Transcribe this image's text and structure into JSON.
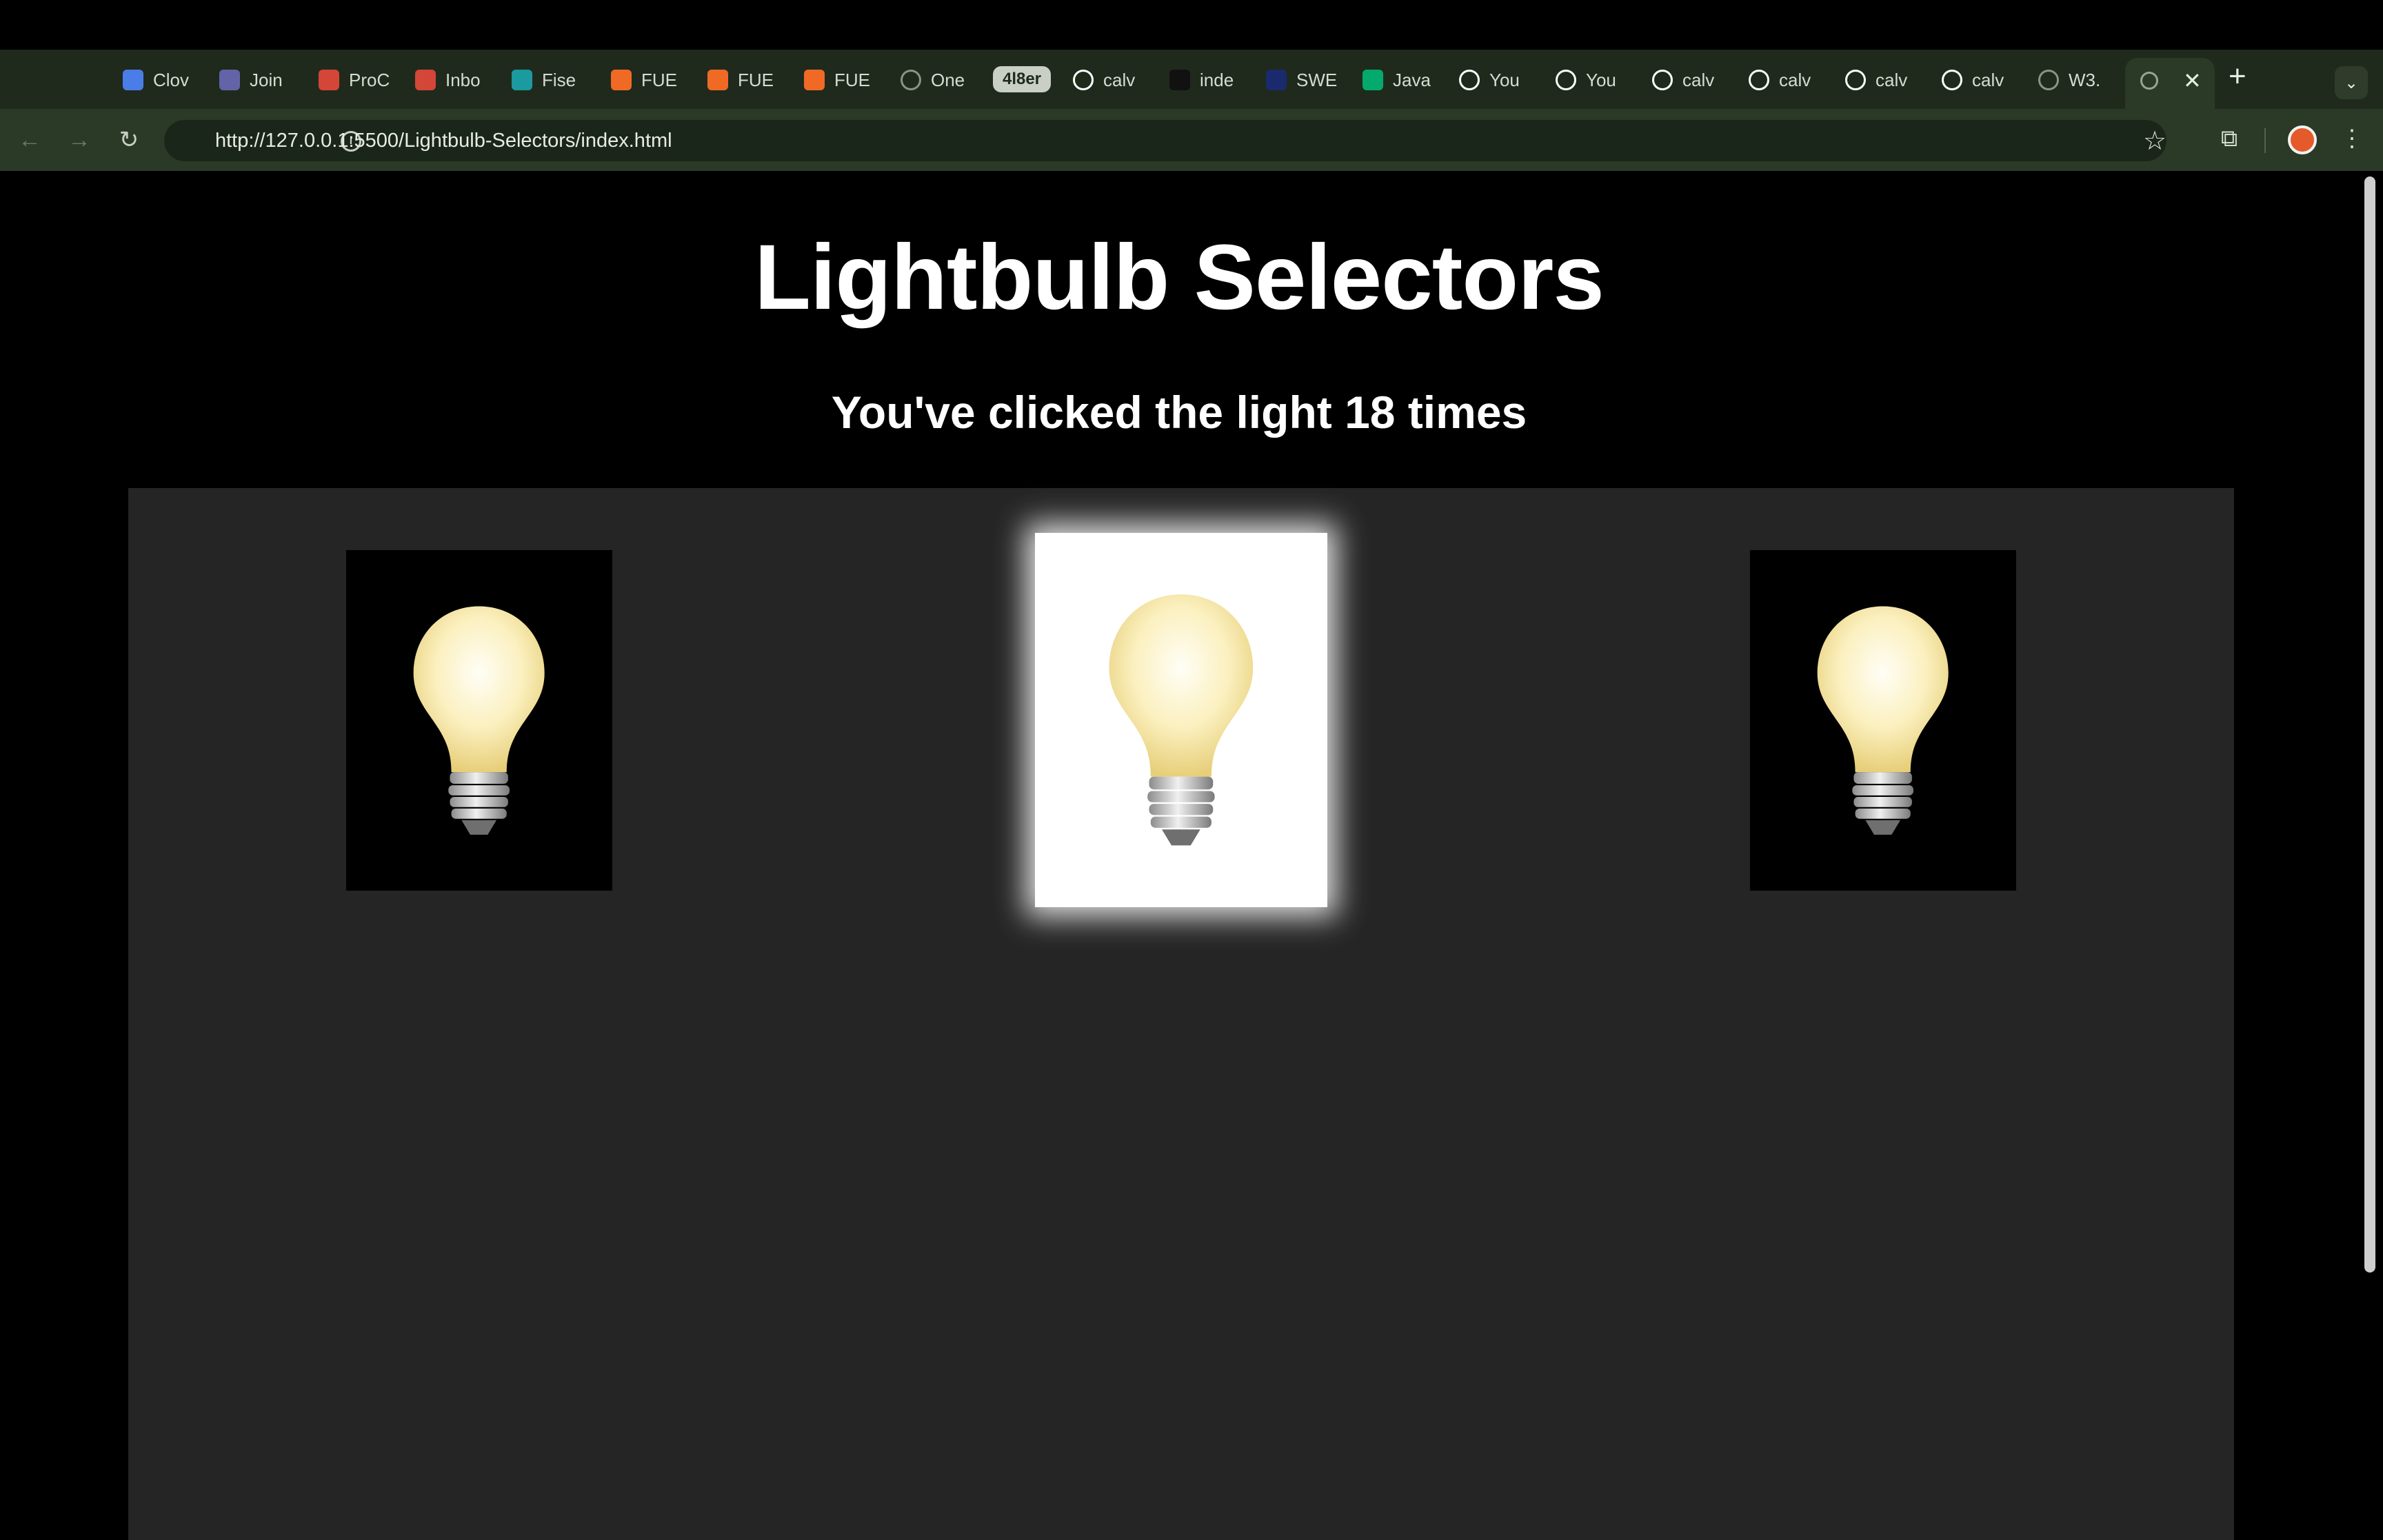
{
  "browser": {
    "tabs": [
      {
        "label": "Clov",
        "favicon": "calendar-icon",
        "color": "#4a7de8"
      },
      {
        "label": "Join",
        "favicon": "teams-icon",
        "color": "#6264a7"
      },
      {
        "label": "ProC",
        "favicon": "gmail-icon",
        "color": "#d44638"
      },
      {
        "label": "Inbo",
        "favicon": "gmail-icon",
        "color": "#d44638"
      },
      {
        "label": "Fise",
        "favicon": "sharepoint-icon",
        "color": "#1b9aa0"
      },
      {
        "label": "FUE",
        "favicon": "orange-square-icon",
        "color": "#f06a25"
      },
      {
        "label": "FUE",
        "favicon": "orange-square-icon",
        "color": "#f06a25"
      },
      {
        "label": "FUE",
        "favicon": "orange-square-icon",
        "color": "#f06a25"
      },
      {
        "label": "One",
        "favicon": "globe-icon",
        "color": "#8a9486"
      },
      {
        "label": "calv",
        "favicon": "github-icon",
        "color": "#ffffff"
      },
      {
        "label": "inde",
        "favicon": "square-icon",
        "color": "#111111"
      },
      {
        "label": "SWE",
        "favicon": "swe-icon",
        "color": "#1a2a6c"
      },
      {
        "label": "Java",
        "favicon": "w3-icon",
        "color": "#04aa6d"
      },
      {
        "label": "You",
        "favicon": "github-icon",
        "color": "#ffffff"
      },
      {
        "label": "You",
        "favicon": "github-icon",
        "color": "#ffffff"
      },
      {
        "label": "calv",
        "favicon": "github-icon",
        "color": "#ffffff"
      },
      {
        "label": "calv",
        "favicon": "github-icon",
        "color": "#ffffff"
      },
      {
        "label": "calv",
        "favicon": "github-icon",
        "color": "#ffffff"
      },
      {
        "label": "calv",
        "favicon": "github-icon",
        "color": "#ffffff"
      },
      {
        "label": "W3.",
        "favicon": "globe-icon",
        "color": "#8a9486"
      }
    ],
    "group_pill": "4l8er",
    "url": "http://127.0.0.1:5500/Lightbulb-Selectors/index.html"
  },
  "page": {
    "title": "Lightbulb Selectors",
    "counter_text": "You've clicked the light 18 times",
    "bulbs": [
      {
        "state": "off"
      },
      {
        "state": "on"
      },
      {
        "state": "off"
      }
    ]
  }
}
